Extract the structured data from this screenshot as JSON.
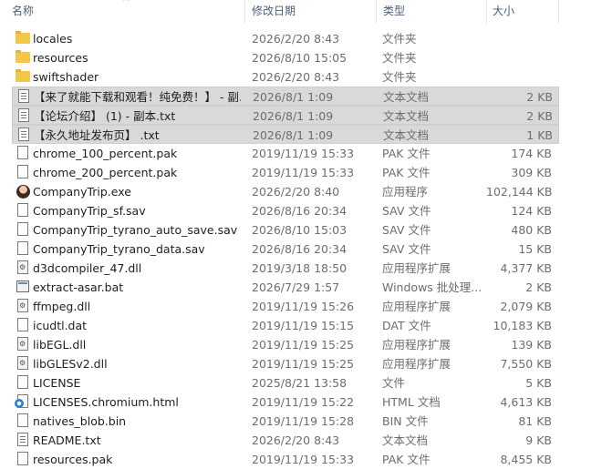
{
  "header": {
    "name": "名称",
    "date": "修改日期",
    "type": "类型",
    "size": "大小"
  },
  "files": [
    {
      "icon": "folder-icon",
      "name": "locales",
      "date": "2026/2/20 8:43",
      "type": "文件夹",
      "size": "",
      "selected": false
    },
    {
      "icon": "folder-icon",
      "name": "resources",
      "date": "2026/8/10 15:05",
      "type": "文件夹",
      "size": "",
      "selected": false
    },
    {
      "icon": "folder-icon",
      "name": "swiftshader",
      "date": "2026/2/20 8:43",
      "type": "文件夹",
      "size": "",
      "selected": false
    },
    {
      "icon": "text-file-icon",
      "name": "【来了就能下载和观看！纯免费！】 - 副...",
      "date": "2026/8/1 1:09",
      "type": "文本文档",
      "size": "2 KB",
      "selected": true
    },
    {
      "icon": "text-file-icon",
      "name": "【论坛介绍】 (1) - 副本.txt",
      "date": "2026/8/1 1:09",
      "type": "文本文档",
      "size": "2 KB",
      "selected": true
    },
    {
      "icon": "text-file-icon",
      "name": "【永久地址发布页】 .txt",
      "date": "2026/8/1 1:09",
      "type": "文本文档",
      "size": "1 KB",
      "selected": true
    },
    {
      "icon": "file-icon",
      "name": "chrome_100_percent.pak",
      "date": "2019/11/19 15:33",
      "type": "PAK 文件",
      "size": "174 KB",
      "selected": false
    },
    {
      "icon": "file-icon",
      "name": "chrome_200_percent.pak",
      "date": "2019/11/19 15:33",
      "type": "PAK 文件",
      "size": "309 KB",
      "selected": false
    },
    {
      "icon": "exe-icon",
      "name": "CompanyTrip.exe",
      "date": "2026/2/20 8:40",
      "type": "应用程序",
      "size": "102,144 KB",
      "selected": false
    },
    {
      "icon": "file-icon",
      "name": "CompanyTrip_sf.sav",
      "date": "2026/8/16 20:34",
      "type": "SAV 文件",
      "size": "124 KB",
      "selected": false
    },
    {
      "icon": "file-icon",
      "name": "CompanyTrip_tyrano_auto_save.sav",
      "date": "2026/8/10 15:03",
      "type": "SAV 文件",
      "size": "480 KB",
      "selected": false
    },
    {
      "icon": "file-icon",
      "name": "CompanyTrip_tyrano_data.sav",
      "date": "2026/8/16 20:34",
      "type": "SAV 文件",
      "size": "15 KB",
      "selected": false
    },
    {
      "icon": "dll-icon",
      "name": "d3dcompiler_47.dll",
      "date": "2019/3/18 18:50",
      "type": "应用程序扩展",
      "size": "4,377 KB",
      "selected": false
    },
    {
      "icon": "batch-file-icon",
      "name": "extract-asar.bat",
      "date": "2026/7/29 1:57",
      "type": "Windows 批处理...",
      "size": "2 KB",
      "selected": false
    },
    {
      "icon": "dll-icon",
      "name": "ffmpeg.dll",
      "date": "2019/11/19 15:26",
      "type": "应用程序扩展",
      "size": "2,079 KB",
      "selected": false
    },
    {
      "icon": "file-icon",
      "name": "icudtl.dat",
      "date": "2019/11/19 15:15",
      "type": "DAT 文件",
      "size": "10,183 KB",
      "selected": false
    },
    {
      "icon": "dll-icon",
      "name": "libEGL.dll",
      "date": "2019/11/19 15:25",
      "type": "应用程序扩展",
      "size": "139 KB",
      "selected": false
    },
    {
      "icon": "dll-icon",
      "name": "libGLESv2.dll",
      "date": "2019/11/19 15:25",
      "type": "应用程序扩展",
      "size": "7,550 KB",
      "selected": false
    },
    {
      "icon": "file-icon",
      "name": "LICENSE",
      "date": "2025/8/21 13:58",
      "type": "文件",
      "size": "5 KB",
      "selected": false
    },
    {
      "icon": "html-file-icon",
      "name": "LICENSES.chromium.html",
      "date": "2019/11/19 15:22",
      "type": "HTML 文档",
      "size": "4,613 KB",
      "selected": false
    },
    {
      "icon": "file-icon",
      "name": "natives_blob.bin",
      "date": "2019/11/19 15:28",
      "type": "BIN 文件",
      "size": "81 KB",
      "selected": false
    },
    {
      "icon": "text-file-icon",
      "name": "README.txt",
      "date": "2026/2/20 8:43",
      "type": "文本文档",
      "size": "9 KB",
      "selected": false
    },
    {
      "icon": "file-icon",
      "name": "resources.pak",
      "date": "2019/11/19 15:33",
      "type": "PAK 文件",
      "size": "8,455 KB",
      "selected": false
    }
  ]
}
